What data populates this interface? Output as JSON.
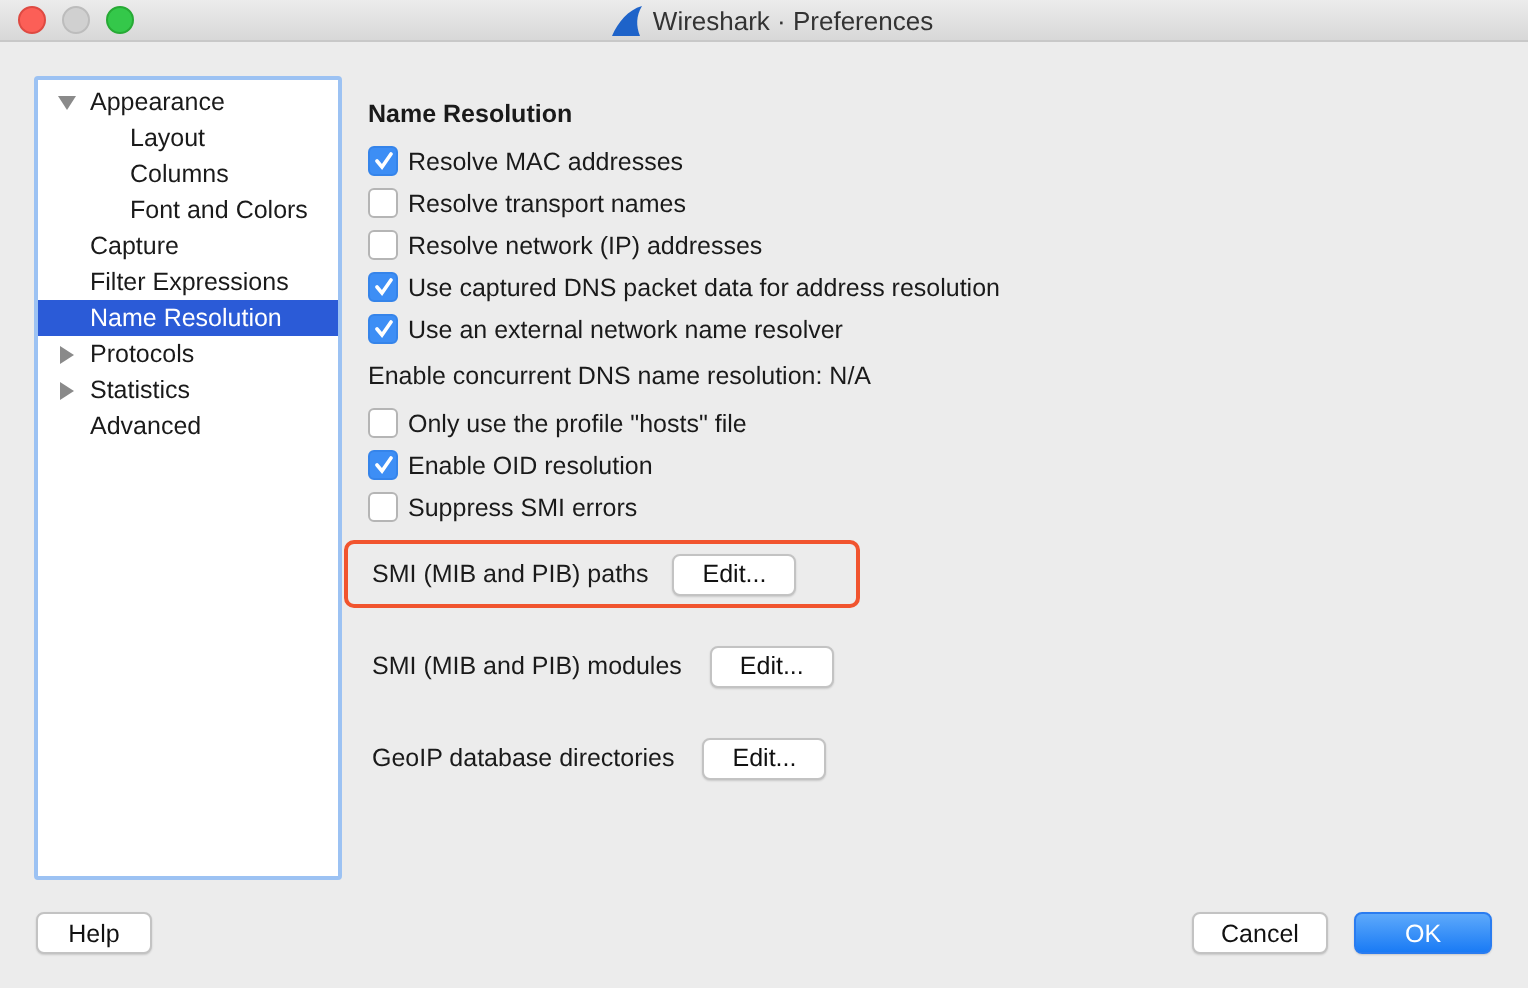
{
  "window": {
    "title": "Wireshark · Preferences"
  },
  "sidebar": {
    "items": [
      {
        "label": "Appearance",
        "expanded": true,
        "selected": false,
        "children": [
          {
            "label": "Layout",
            "selected": false
          },
          {
            "label": "Columns",
            "selected": false
          },
          {
            "label": "Font and Colors",
            "selected": false
          }
        ]
      },
      {
        "label": "Capture",
        "selected": false
      },
      {
        "label": "Filter Expressions",
        "selected": false
      },
      {
        "label": "Name Resolution",
        "selected": true
      },
      {
        "label": "Protocols",
        "expanded": false,
        "selected": false
      },
      {
        "label": "Statistics",
        "expanded": false,
        "selected": false
      },
      {
        "label": "Advanced",
        "selected": false
      }
    ]
  },
  "panel": {
    "title": "Name Resolution",
    "items": [
      {
        "kind": "checkbox",
        "label": "Resolve MAC addresses",
        "checked": true
      },
      {
        "kind": "checkbox",
        "label": "Resolve transport names",
        "checked": false
      },
      {
        "kind": "checkbox",
        "label": "Resolve network (IP) addresses",
        "checked": false
      },
      {
        "kind": "checkbox",
        "label": "Use captured DNS packet data for address resolution",
        "checked": true
      },
      {
        "kind": "checkbox",
        "label": "Use an external network name resolver",
        "checked": true
      },
      {
        "kind": "text",
        "label": "Enable concurrent DNS name resolution: N/A"
      },
      {
        "kind": "checkbox",
        "label": "Only use the profile \"hosts\" file",
        "checked": false
      },
      {
        "kind": "checkbox",
        "label": "Enable OID resolution",
        "checked": true
      },
      {
        "kind": "checkbox",
        "label": "Suppress SMI errors",
        "checked": false
      },
      {
        "kind": "edit",
        "label": "SMI (MIB and PIB) paths",
        "button": "Edit...",
        "highlighted": true
      },
      {
        "kind": "edit",
        "label": "SMI (MIB and PIB) modules",
        "button": "Edit...",
        "highlighted": false
      },
      {
        "kind": "edit",
        "label": "GeoIP database directories",
        "button": "Edit...",
        "highlighted": false
      }
    ]
  },
  "buttons": {
    "help": "Help",
    "cancel": "Cancel",
    "ok": "OK"
  }
}
